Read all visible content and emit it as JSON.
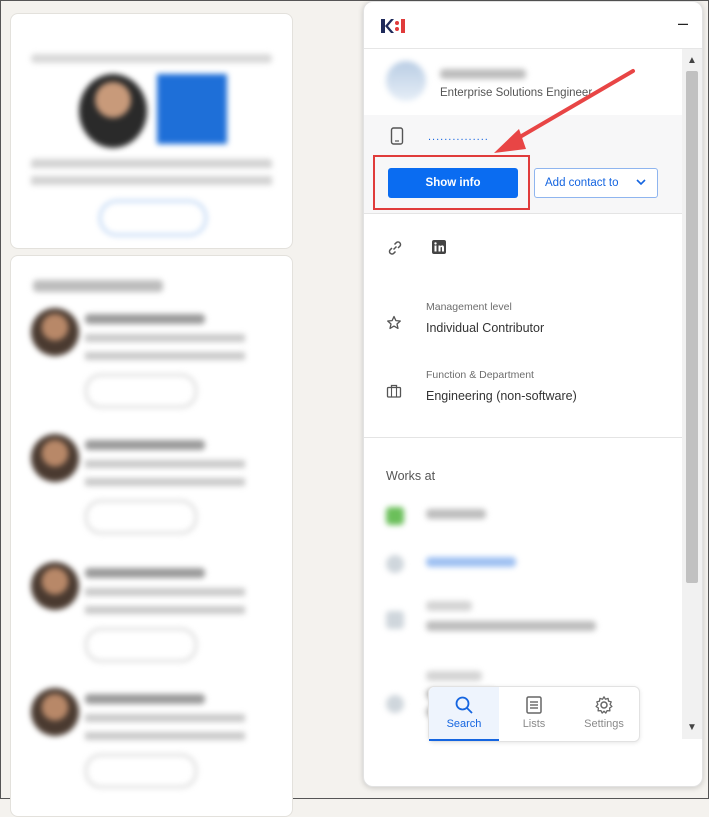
{
  "panel": {
    "contact": {
      "title": "Enterprise Solutions Engineer"
    },
    "phone_masked": "...............",
    "show_info_label": "Show info",
    "add_contact_label": "Add contact to",
    "management_level": {
      "label": "Management level",
      "value": "Individual Contributor"
    },
    "function_department": {
      "label": "Function & Department",
      "value": "Engineering (non-software)"
    },
    "works_at_label": "Works at",
    "nav": [
      {
        "label": "Search",
        "icon": "search-icon"
      },
      {
        "label": "Lists",
        "icon": "list-icon"
      },
      {
        "label": "Settings",
        "icon": "gear-icon"
      }
    ]
  },
  "colors": {
    "primary_button": "#0a6cf1",
    "link_blue": "#1565e0",
    "annotation_red": "#e03b3b"
  }
}
